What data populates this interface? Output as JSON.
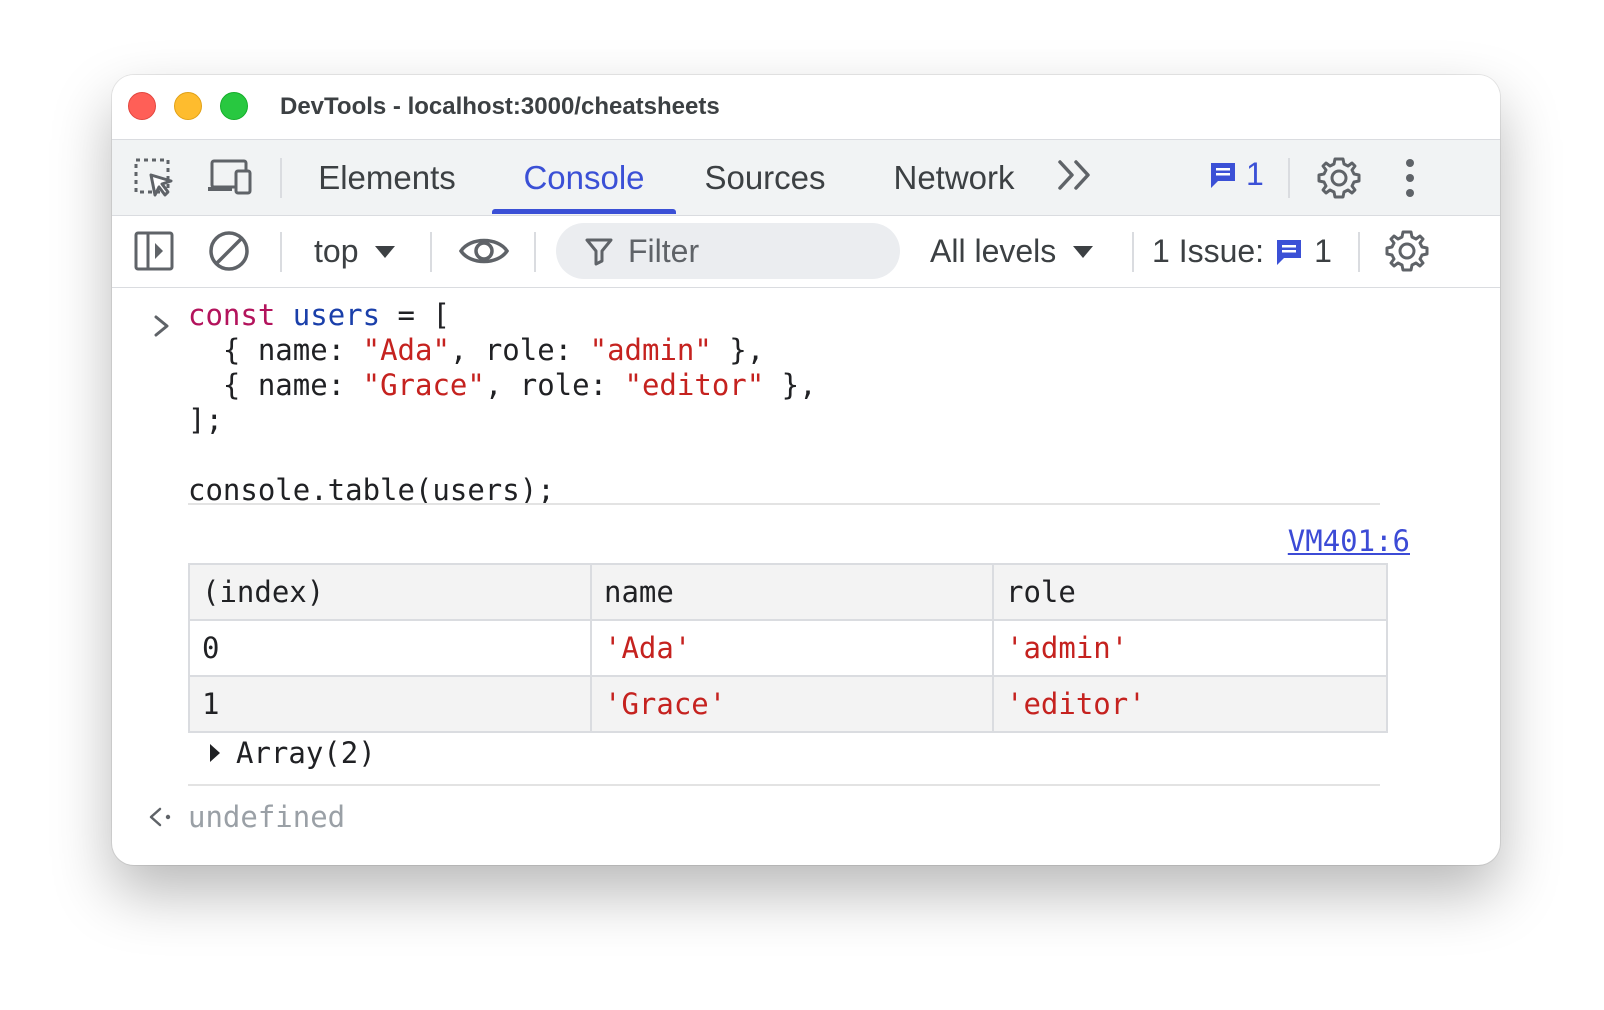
{
  "window": {
    "title": "DevTools - localhost:3000/cheatsheets"
  },
  "tabs": {
    "items": [
      "Elements",
      "Console",
      "Sources",
      "Network"
    ],
    "active": "Console",
    "issues_count": "1",
    "accent_color": "#3b50d6"
  },
  "toolbar": {
    "context": "top",
    "filter_placeholder": "Filter",
    "levels": "All levels",
    "issues_label": "1 Issue:",
    "issues_count": "1"
  },
  "console": {
    "input": {
      "line1_kw": "const",
      "line1_var": "users",
      "line1_rest": " = [",
      "line2_a": "  { name: ",
      "line2_name": "\"Ada\"",
      "line2_b": ", role: ",
      "line2_role": "\"admin\"",
      "line2_c": " },",
      "line3_a": "  { name: ",
      "line3_name": "\"Grace\"",
      "line3_b": ", role: ",
      "line3_role": "\"editor\"",
      "line3_c": " },",
      "line4": "];",
      "line6": "console.table(users);"
    },
    "source_link": "VM401:6",
    "table": {
      "headers": [
        "(index)",
        "name",
        "role"
      ],
      "rows": [
        [
          "0",
          "'Ada'",
          "'admin'"
        ],
        [
          "1",
          "'Grace'",
          "'editor'"
        ]
      ]
    },
    "array_label": "Array(2)",
    "result": "undefined"
  }
}
